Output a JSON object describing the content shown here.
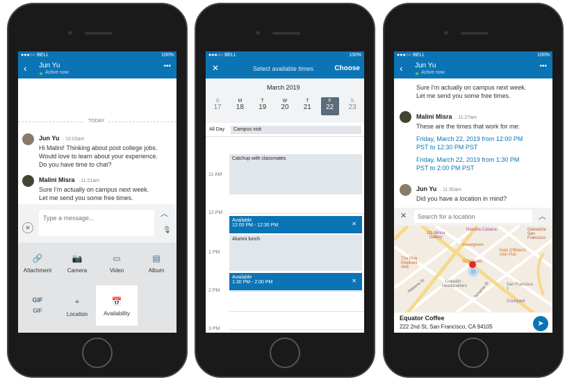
{
  "status": {
    "carrier": "●●●○○ BELL",
    "battery": "100%"
  },
  "colors": {
    "brand": "#0b74b5",
    "event": "#0b74b5"
  },
  "phone1": {
    "header": {
      "name": "Jun Yu",
      "presence": "Active now"
    },
    "divider": "TODAY",
    "messages": [
      {
        "name": "Jun Yu",
        "time": "10:03am",
        "text": [
          "Hi Malini! Thinking about post college jobs.",
          "Would love to learn about your experience.",
          "Do you have time to chat?"
        ]
      },
      {
        "name": "Malini Misra",
        "time": "11:21am",
        "text": [
          "Sure I'm actually on campus next week.",
          "Let me send you some free times."
        ]
      }
    ],
    "input_placeholder": "Type a message...",
    "attachments": [
      {
        "label": "Attachment",
        "icon": "paperclip-icon"
      },
      {
        "label": "Camera",
        "icon": "camera-icon"
      },
      {
        "label": "Video",
        "icon": "video-icon"
      },
      {
        "label": "Album",
        "icon": "album-icon"
      },
      {
        "label": "GIF",
        "icon": "gif-icon"
      },
      {
        "label": "Location",
        "icon": "location-pin-icon"
      },
      {
        "label": "Availability",
        "icon": "calendar-icon"
      }
    ]
  },
  "phone2": {
    "header": {
      "title": "Select available times",
      "action": "Choose"
    },
    "month": "March 2019",
    "days": [
      {
        "d": "S",
        "n": "17"
      },
      {
        "d": "M",
        "n": "18"
      },
      {
        "d": "T",
        "n": "19"
      },
      {
        "d": "W",
        "n": "20"
      },
      {
        "d": "T",
        "n": "21"
      },
      {
        "d": "F",
        "n": "22"
      },
      {
        "d": "S",
        "n": "23"
      }
    ],
    "all_day_label": "All Day",
    "all_day_event": "Campus visit",
    "hours": [
      "11 AM",
      "12 PM",
      "1 PM",
      "2 PM",
      "3 PM"
    ],
    "events": [
      {
        "title": "Catchup with classmates"
      },
      {
        "title": "Available",
        "time": "12:00 PM - 12:30 PM"
      },
      {
        "title": "Alumni lunch"
      },
      {
        "title": "Available",
        "time": "1:30 PM - 2:00 PM"
      }
    ]
  },
  "phone3": {
    "header": {
      "name": "Jun Yu",
      "presence": "Active now"
    },
    "top_text": [
      "Sure I'm actually on campus next week.",
      "Let me send you some free times."
    ],
    "msg1": {
      "name": "Malini Misra",
      "time": "11:27am",
      "text": "These are the times that work for me:",
      "links": [
        [
          "Friday, March 22, 2019 from 12:00 PM",
          "PST to 12:30 PM PST"
        ],
        [
          "Friday, March 22, 2019 from 1:30 PM",
          "PST to 2:00 PM PST"
        ]
      ]
    },
    "msg2": {
      "name": "Jun Yu",
      "time": "11:30am",
      "text": "Did you have a location in mind?"
    },
    "search_placeholder": "Search for a location",
    "map_labels": [
      "Natoma Cabana",
      "111 Minna Gallery",
      "sweetgreen",
      "Kate O'Brien's Irish Pub",
      "The Pink Elephant Alibi",
      "SOMAeats",
      "LinkedIn - Headquarters",
      "San Francisco 1",
      "Courtyard",
      "Galvanize San Francisco",
      "Natoma St",
      "Tehama St"
    ],
    "place": {
      "name": "Equator Coffee",
      "address": "222 2nd St, San Francisco, CA 94105"
    }
  }
}
